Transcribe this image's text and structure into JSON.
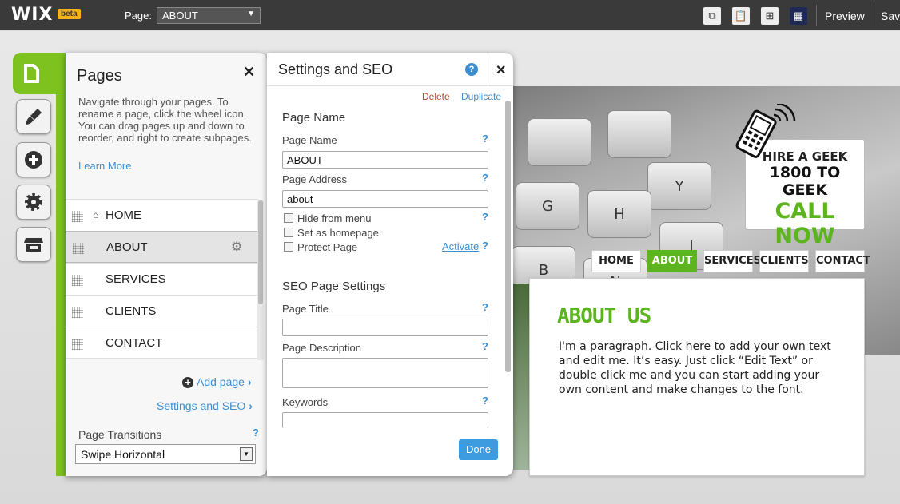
{
  "topbar": {
    "logo": "WIX",
    "beta": "beta",
    "page_label": "Page:",
    "page_value": "ABOUT",
    "preview": "Preview",
    "save": "Save"
  },
  "pages_panel": {
    "title": "Pages",
    "help": "Navigate through your pages. To rename a page, click the wheel icon. You can drag pages up and down to reorder, and right to create subpages.",
    "learn_more": "Learn More",
    "pages": [
      "HOME",
      "ABOUT",
      "SERVICES",
      "CLIENTS",
      "CONTACT"
    ],
    "selected": "ABOUT",
    "add_page": "Add page",
    "settings_seo": "Settings and SEO",
    "transitions_label": "Page Transitions",
    "transitions_value": "Swipe Horizontal",
    "help_q": "?"
  },
  "seo_panel": {
    "title": "Settings and SEO",
    "delete": "Delete",
    "duplicate": "Duplicate",
    "page_name_section": "Page Name",
    "page_name_label": "Page Name",
    "page_name_value": "ABOUT",
    "page_address_label": "Page Address",
    "page_address_value": "about",
    "hide_from_menu": "Hide from menu",
    "set_homepage": "Set as homepage",
    "protect_page": "Protect Page",
    "activate": "Activate",
    "seo_section": "SEO Page Settings",
    "page_title_label": "Page Title",
    "page_title_value": "",
    "page_description_label": "Page Description",
    "keywords_label": "Keywords",
    "done": "Done",
    "q": "?"
  },
  "site": {
    "banner_line1": "HIRE A GEEK",
    "banner_line2": "1800 TO GEEK",
    "banner_line3": "CALL NOW",
    "nav": [
      "HOME",
      "ABOUT",
      "SERVICES",
      "CLIENTS",
      "CONTACT"
    ],
    "about_heading": "ABOUT US",
    "about_text": "I'm a paragraph. Click here to add your own text and edit me. It’s easy. Just click “Edit Text” or double click me and you can start adding your own content and make changes to the font.",
    "keys": [
      "Y",
      "G",
      "H",
      "J",
      "B",
      "N"
    ],
    "accent_color": "#5cb51e"
  }
}
